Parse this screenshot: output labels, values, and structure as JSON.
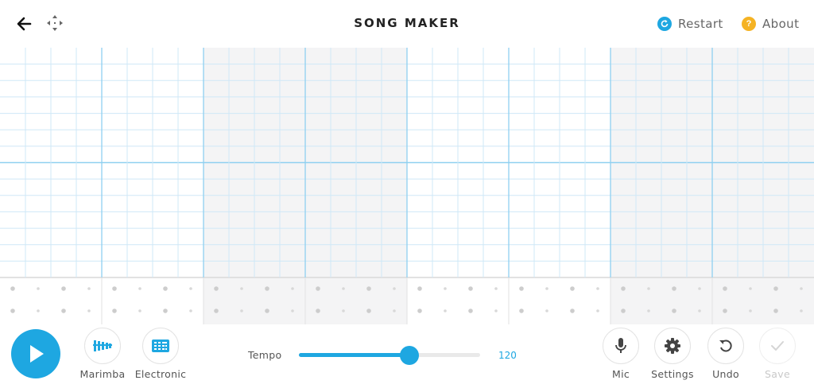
{
  "header": {
    "title": "SONG MAKER",
    "restart_label": "Restart",
    "about_label": "About",
    "back_icon": "arrow-left-icon",
    "move_icon": "move-arrows-icon",
    "restart_icon": "refresh-icon",
    "about_icon": "question-icon"
  },
  "grid": {
    "bars": 4,
    "beats_per_bar": 2,
    "subdivisions_per_beat": 4,
    "melody_rows": 14,
    "octave_split_after_row": 7,
    "percussion_rows": 2,
    "shaded_bars": [
      1,
      3
    ]
  },
  "footer": {
    "instrument_label": "Marimba",
    "percussion_label": "Electronic",
    "tempo_label": "Tempo",
    "tempo_value": "120",
    "tempo_fraction": 0.61,
    "mic_label": "Mic",
    "settings_label": "Settings",
    "undo_label": "Undo",
    "save_label": "Save",
    "icons": {
      "play": "play-icon",
      "instrument": "marimba-icon",
      "percussion": "drum-machine-icon",
      "mic": "mic-icon",
      "settings": "gear-icon",
      "undo": "undo-icon",
      "save": "check-icon"
    }
  },
  "colors": {
    "accent": "#1ea7e1",
    "restart_dot": "#1ea7e1",
    "about_dot": "#f5b324",
    "grid_line": "#cfe8f7",
    "beat_line": "#8fd0f0",
    "shaded_bar": "#f4f4f5"
  }
}
